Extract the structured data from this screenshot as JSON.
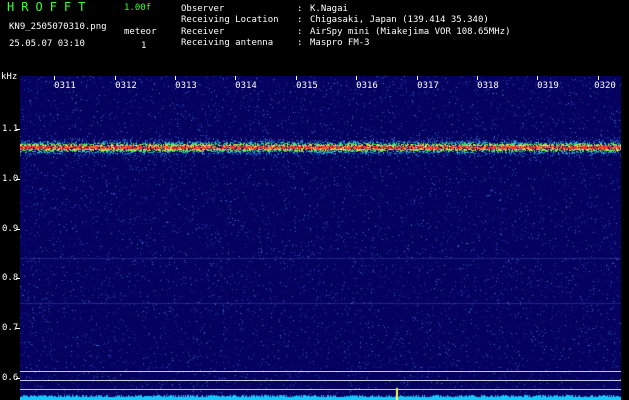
{
  "header": {
    "app_title": "HROFFT",
    "version": "1.00f",
    "filename": "KN9_2505070310.png",
    "datetime": "25.05.07 03:10",
    "mode": "meteor",
    "count": "1"
  },
  "meta": [
    {
      "key": "Observer",
      "value": "K.Nagai"
    },
    {
      "key": "Receiving Location",
      "value": "Chigasaki, Japan (139.414 35.340)"
    },
    {
      "key": "Receiver",
      "value": "AirSpy mini (Miakejima VOR 108.65MHz)"
    },
    {
      "key": "Receiving antenna",
      "value": "Maspro FM-3"
    }
  ],
  "meta_separator": ":",
  "axis": {
    "unit": "kHz",
    "y_ticks": [
      "1.1",
      "1.0",
      "0.9",
      "0.8",
      "0.7",
      "0.6"
    ],
    "x_ticks": [
      "0311",
      "0312",
      "0313",
      "0314",
      "0315",
      "0316",
      "0317",
      "0318",
      "0319",
      "0320"
    ]
  },
  "colors": {
    "background": "#000000",
    "plot_background": "#04025e",
    "title_green": "#39ff39",
    "carrier": "#ff3030",
    "noise_floor": "#19c7ff"
  }
}
